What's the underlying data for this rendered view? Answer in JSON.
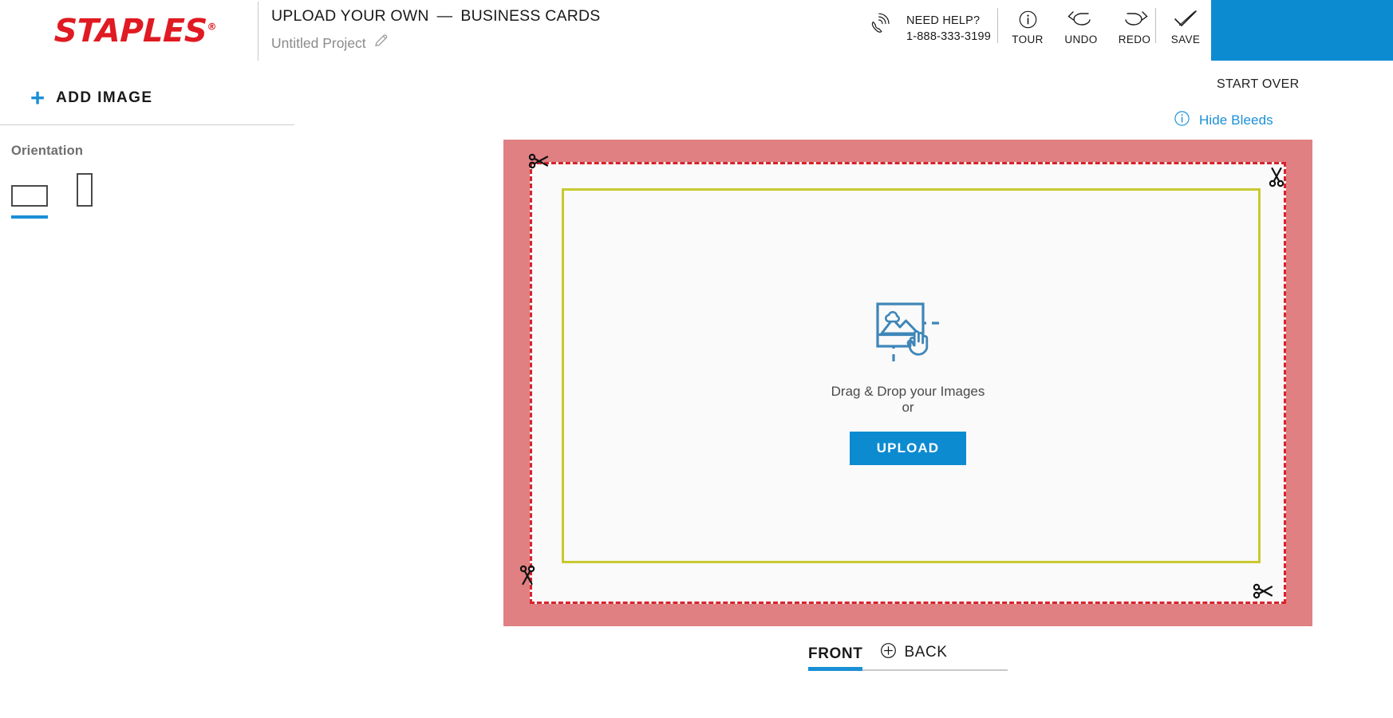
{
  "header": {
    "brand": "STAPLES",
    "brand_registered": "®",
    "title_primary": "UPLOAD YOUR OWN",
    "title_separator": "—",
    "title_secondary": "BUSINESS CARDS",
    "project_name": "Untitled Project",
    "edit_icon": "pencil-icon",
    "help": {
      "icon": "phone-ringing-icon",
      "label": "NEED HELP?",
      "phone": "1-888-333-3199"
    },
    "tools": [
      {
        "label": "TOUR",
        "icon": "info-circle-icon"
      },
      {
        "label": "UNDO",
        "icon": "undo-arrow-icon"
      },
      {
        "label": "REDO",
        "icon": "redo-arrow-icon"
      },
      {
        "label": "SAVE",
        "icon": "checkmark-icon"
      }
    ],
    "action_button_color": "#0d8bd1",
    "start_over_label": "START OVER"
  },
  "sidebar": {
    "add_image_label": "ADD  IMAGE",
    "add_image_icon": "plus-icon",
    "orientation_title": "Orientation",
    "orientation_options": [
      {
        "name": "landscape",
        "selected": true
      },
      {
        "name": "portrait",
        "selected": false
      }
    ]
  },
  "canvas": {
    "bleeds_toggle_label": "Hide Bleeds",
    "bleeds_info_icon": "info-circle-icon",
    "bleed_color": "#e08083",
    "trim_line_color": "#d8232a",
    "safe_line_color": "#c8c832",
    "artboard_color": "#fafafa",
    "corner_icon": "scissors-icon",
    "dropzone": {
      "icon": "image-upload-drag-icon",
      "prompt": "Drag & Drop your Images",
      "or": "or",
      "button_label": "UPLOAD"
    }
  },
  "side_tabs": [
    {
      "label": "FRONT",
      "active": true,
      "icon": ""
    },
    {
      "label": "BACK",
      "active": false,
      "icon": "plus-circle-icon"
    }
  ]
}
